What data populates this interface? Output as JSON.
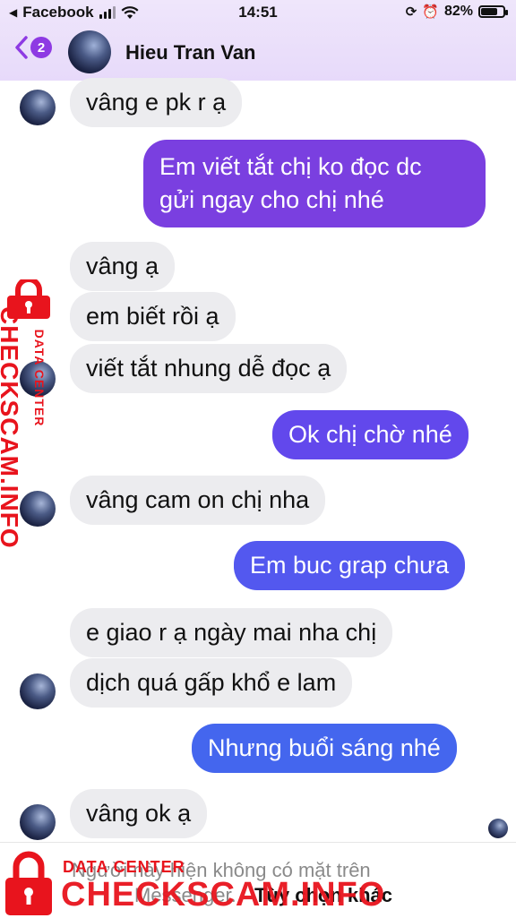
{
  "status_bar": {
    "back_app": "Facebook",
    "time": "14:51",
    "battery_percent": "82%",
    "battery_level": 0.82
  },
  "header": {
    "back_count": "2",
    "contact_name": "Hieu Tran Van"
  },
  "messages": [
    {
      "direction": "received",
      "text": "vâng e pk r ạ"
    },
    {
      "direction": "sent",
      "text_line1": "Em viết tắt chị ko đọc dc",
      "text_line2": "gửi ngay cho chị nhé"
    },
    {
      "direction": "received",
      "text": "vâng ạ"
    },
    {
      "direction": "received",
      "text": "em biết rồi ạ"
    },
    {
      "direction": "received",
      "text": "viết tắt nhung dễ đọc ạ"
    },
    {
      "direction": "sent",
      "text": "Ok chị chờ nhé"
    },
    {
      "direction": "received",
      "text": "vâng cam on chị nha"
    },
    {
      "direction": "sent",
      "text": "Em buc grap chưa"
    },
    {
      "direction": "received",
      "text": "e giao r ạ ngày mai nha chị"
    },
    {
      "direction": "received",
      "text": "dịch quá gấp khổ e lam"
    },
    {
      "direction": "sent",
      "text": "Nhưng buổi sáng nhé"
    },
    {
      "direction": "received",
      "text": "vâng ok ạ"
    }
  ],
  "footer": {
    "line1": "Người này hiện không có mặt trên",
    "line2": "Messenger.",
    "option": "Tùy chọn khác"
  },
  "watermark": {
    "main": "CHECKSCAM.INFO",
    "sub": "DATA CENTER"
  },
  "colors": {
    "sent_purple": "#7a3fe0",
    "sent_indigo": "#5a4ff0",
    "sent_blue": "#4466ee",
    "received_bg": "#ececef",
    "watermark_red": "#e8141d"
  }
}
